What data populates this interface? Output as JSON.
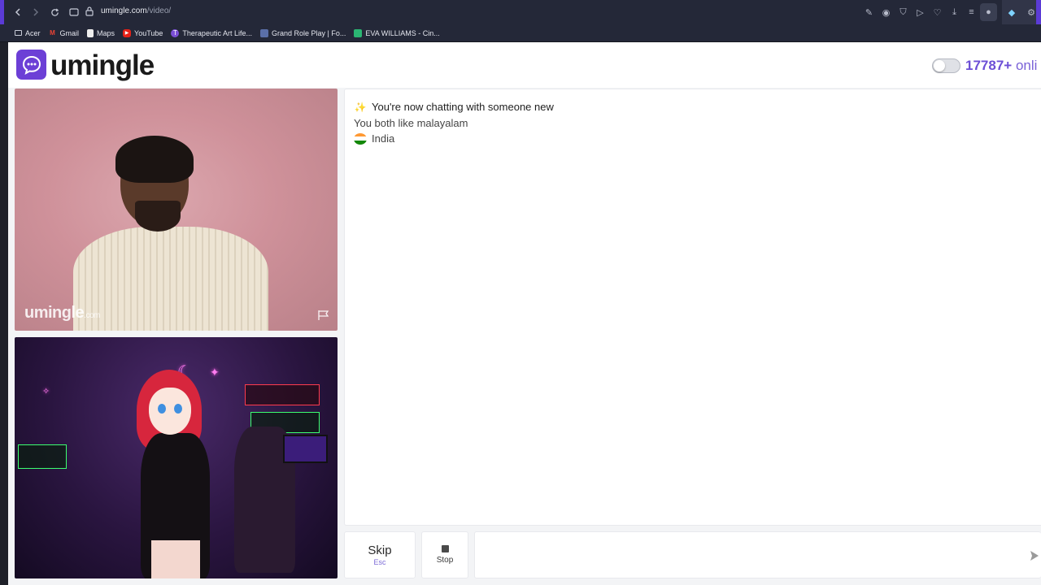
{
  "browser": {
    "url_host": "umingle.com",
    "url_path": "/video/",
    "bookmarks": [
      {
        "label": "Acer",
        "icon": "folder-icon"
      },
      {
        "label": "Gmail",
        "icon": "gmail-icon"
      },
      {
        "label": "Maps",
        "icon": "maps-icon"
      },
      {
        "label": "YouTube",
        "icon": "youtube-icon"
      },
      {
        "label": "Therapeutic Art Life...",
        "icon": "site-icon"
      },
      {
        "label": "Grand Role Play | Fo...",
        "icon": "site-icon"
      },
      {
        "label": "EVA WILLIAMS - Cin...",
        "icon": "site-icon"
      }
    ]
  },
  "header": {
    "brand": "umingle",
    "online_count": "17787+",
    "online_suffix": "onli"
  },
  "video": {
    "watermark_brand": "umingle",
    "watermark_tld": ".com"
  },
  "chat": {
    "intro": "You're now chatting with someone new",
    "interests": "You both like malayalam",
    "country": "India"
  },
  "controls": {
    "skip_label": "Skip",
    "skip_shortcut": "Esc",
    "stop_label": "Stop",
    "message_placeholder": ""
  },
  "colors": {
    "brand": "#6c3fd6",
    "online_text": "#6c4fd6",
    "browser_chrome": "#242838"
  }
}
